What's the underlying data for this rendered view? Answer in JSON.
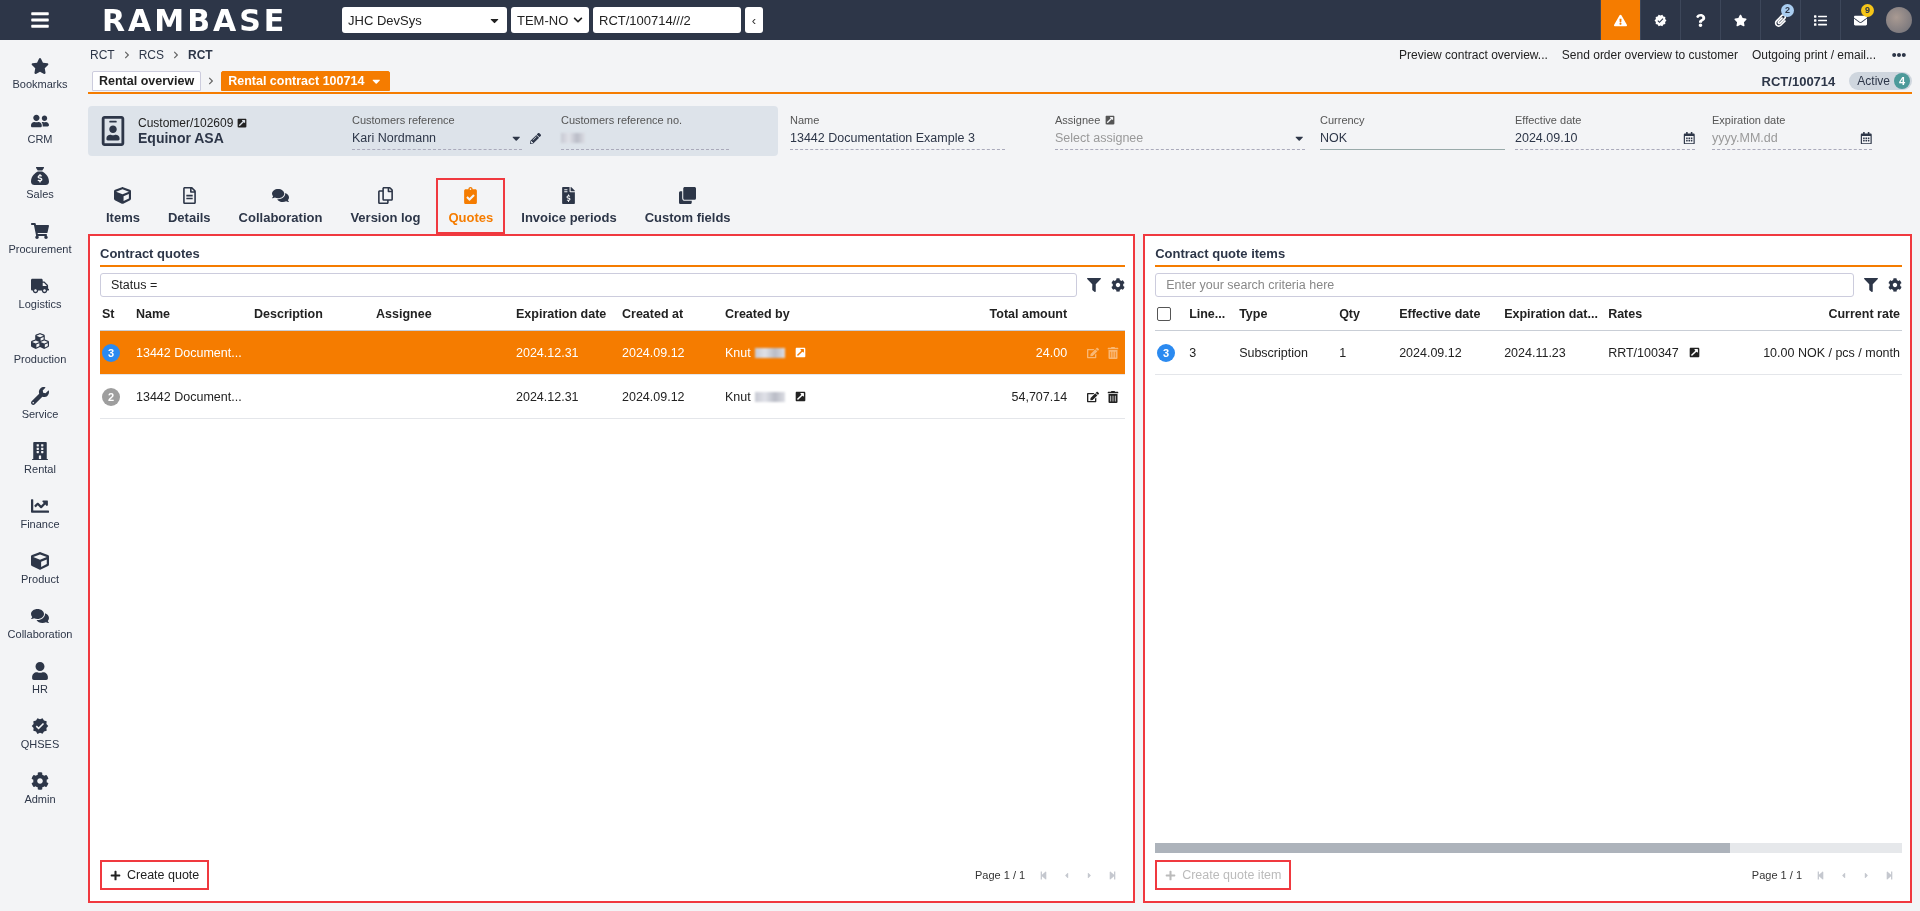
{
  "topbar": {
    "logo": "RAMBASE",
    "company": "JHC DevSys",
    "locale": "TEM-NO",
    "object_path": "RCT/100714///2",
    "collapse": "‹"
  },
  "toolbar_buttons": [
    {
      "selected": true
    },
    {
      "selected": false
    },
    {
      "selected": false
    },
    {
      "selected": false
    },
    {
      "selected": false,
      "badge": "2"
    },
    {
      "selected": false
    },
    {
      "selected": false,
      "badge": "9"
    }
  ],
  "sidebar": {
    "items": [
      "Bookmarks",
      "CRM",
      "Sales",
      "Procurement",
      "Logistics",
      "Production",
      "Service",
      "Rental",
      "Finance",
      "Product",
      "Collaboration",
      "HR",
      "QHSES",
      "Admin"
    ]
  },
  "breadcrumb": [
    "RCT",
    "RCS",
    "RCT"
  ],
  "actions": [
    "Preview contract overview...",
    "Send order overview to customer",
    "Outgoing print / email..."
  ],
  "doc_tabs": [
    {
      "label": "Rental overview",
      "selected": false
    },
    {
      "label": "Rental contract 100714",
      "selected": true
    }
  ],
  "document": {
    "id": "RCT/100714",
    "status": "Active",
    "status_count": "4"
  },
  "customer": {
    "id": "Customer/102609",
    "name": "Equinor ASA",
    "reference": {
      "label": "Customers reference",
      "value": "Kari Nordmann"
    },
    "reference_no": {
      "label": "Customers reference no."
    }
  },
  "fields": [
    {
      "kind": "text",
      "label": "Name",
      "value": "13442 Documentation Example 3"
    },
    {
      "kind": "select",
      "label": "Assignee",
      "placeholder": "Select assignee"
    },
    {
      "kind": "readonly",
      "label": "Currency",
      "value": "NOK"
    },
    {
      "kind": "date",
      "label": "Effective date",
      "value": "2024.09.10"
    },
    {
      "kind": "date",
      "label": "Expiration date",
      "placeholder": "yyyy.MM.dd"
    }
  ],
  "tabs": [
    {
      "label": "Items",
      "selected": false,
      "highlighted": false
    },
    {
      "label": "Details",
      "selected": false,
      "highlighted": false
    },
    {
      "label": "Collaboration",
      "selected": false,
      "highlighted": false
    },
    {
      "label": "Version log",
      "selected": false,
      "highlighted": false
    },
    {
      "label": "Quotes",
      "selected": true,
      "highlighted": true
    },
    {
      "label": "Invoice periods",
      "selected": false,
      "highlighted": false
    },
    {
      "label": "Custom fields",
      "selected": false,
      "highlighted": false
    }
  ],
  "quotes_panel": {
    "title": "Contract quotes",
    "highlighted": true,
    "filter": {
      "value": "Status ="
    },
    "columns": [
      "St",
      "Name",
      "Description",
      "Assignee",
      "Expiration date",
      "Created at",
      "Created by",
      "Total amount"
    ],
    "rows": [
      {
        "status": "3",
        "color": "#2b8af0",
        "name": "13442 Document...",
        "expiration_date": "2024.12.31",
        "created_at": "2024.09.12",
        "created_by": "Knut",
        "total_amount": "24.00",
        "selected": true
      },
      {
        "status": "2",
        "color": "#9e9e9e",
        "name": "13442 Document...",
        "expiration_date": "2024.12.31",
        "created_at": "2024.09.12",
        "created_by": "Knut",
        "total_amount": "54,707.14",
        "selected": false
      }
    ],
    "create_button": {
      "label": "Create quote",
      "highlighted": true,
      "disabled": false
    },
    "pager": "Page 1 / 1"
  },
  "quote_items_panel": {
    "title": "Contract quote items",
    "highlighted": true,
    "search": {
      "placeholder": "Enter your search criteria here"
    },
    "select_all": {
      "checked": false
    },
    "columns": [
      "Line...",
      "Type",
      "Qty",
      "Effective date",
      "Expiration dat...",
      "Rates",
      "Current rate"
    ],
    "rows": [
      {
        "status": "3",
        "color": "#2b8af0",
        "line": "3",
        "type": "Subscription",
        "qty": "1",
        "effective_date": "2024.09.12",
        "expiration_date": "2024.11.23",
        "rates": "RRT/100347",
        "current_rate": "10.00 NOK / pcs / month"
      }
    ],
    "create_button": {
      "label": "Create quote item",
      "highlighted": true,
      "disabled": true
    },
    "pager": "Page 1 / 1"
  }
}
